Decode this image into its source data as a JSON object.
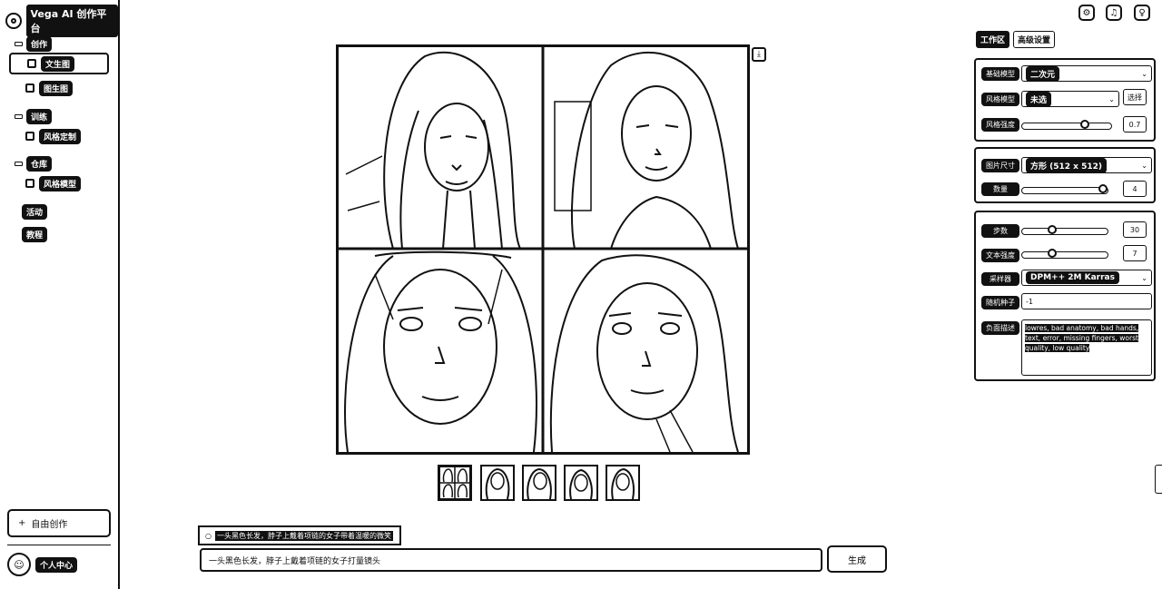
{
  "app": {
    "title": "Vega AI 创作平台"
  },
  "sidebar": {
    "groups": [
      {
        "label": "创作",
        "items": [
          "文生图",
          "图生图"
        ]
      },
      {
        "label": "训练",
        "items": [
          "风格定制"
        ]
      },
      {
        "label": "仓库",
        "items": [
          "风格模型"
        ]
      },
      {
        "label": "活动",
        "items": []
      },
      {
        "label": "教程",
        "items": []
      }
    ],
    "active_item": "文生图",
    "new_button": {
      "icon": "+",
      "label": "自由创作"
    },
    "profile": {
      "label": "个人中心"
    }
  },
  "top_icons": [
    "settings-icon",
    "bell-icon",
    "user-icon"
  ],
  "thumbnails": {
    "count": 5,
    "selected_index": 0
  },
  "prompt": {
    "suggestion": "一头黑色长发，脖子上戴着项链的女子带着温暖的微笑",
    "value": "一头黑色长发，脖子上戴着项链的女子打量镜头",
    "generate_label": "生成"
  },
  "panel": {
    "tabs": [
      "工作区",
      "高级设置"
    ],
    "active_tab": 0,
    "base": {
      "model_label": "基础模型",
      "model_value": "二次元",
      "style_label": "风格模型",
      "style_value": "未选",
      "style_btn": "选择",
      "weight_label": "风格强度",
      "weight_value": 0.7,
      "weight_btn": "0.7"
    },
    "size": {
      "size_label": "图片尺寸",
      "size_value": "方形 (512 x 512)",
      "count_label": "数量",
      "count_value": "4",
      "count_level": 1.0
    },
    "advanced": {
      "steps_label": "步数",
      "steps_value": "30",
      "steps_level": 0.35,
      "cfg_label": "文本强度",
      "cfg_value": "7",
      "cfg_level": 0.35,
      "sampler_label": "采样器",
      "sampler_value": "DPM++ 2M Karras",
      "seed_label": "随机种子",
      "seed_value": "-1",
      "neg_label": "负面描述",
      "neg_value": "lowres, bad anatomy, bad hands, text, error, missing fingers, worst quality, low quality"
    }
  }
}
